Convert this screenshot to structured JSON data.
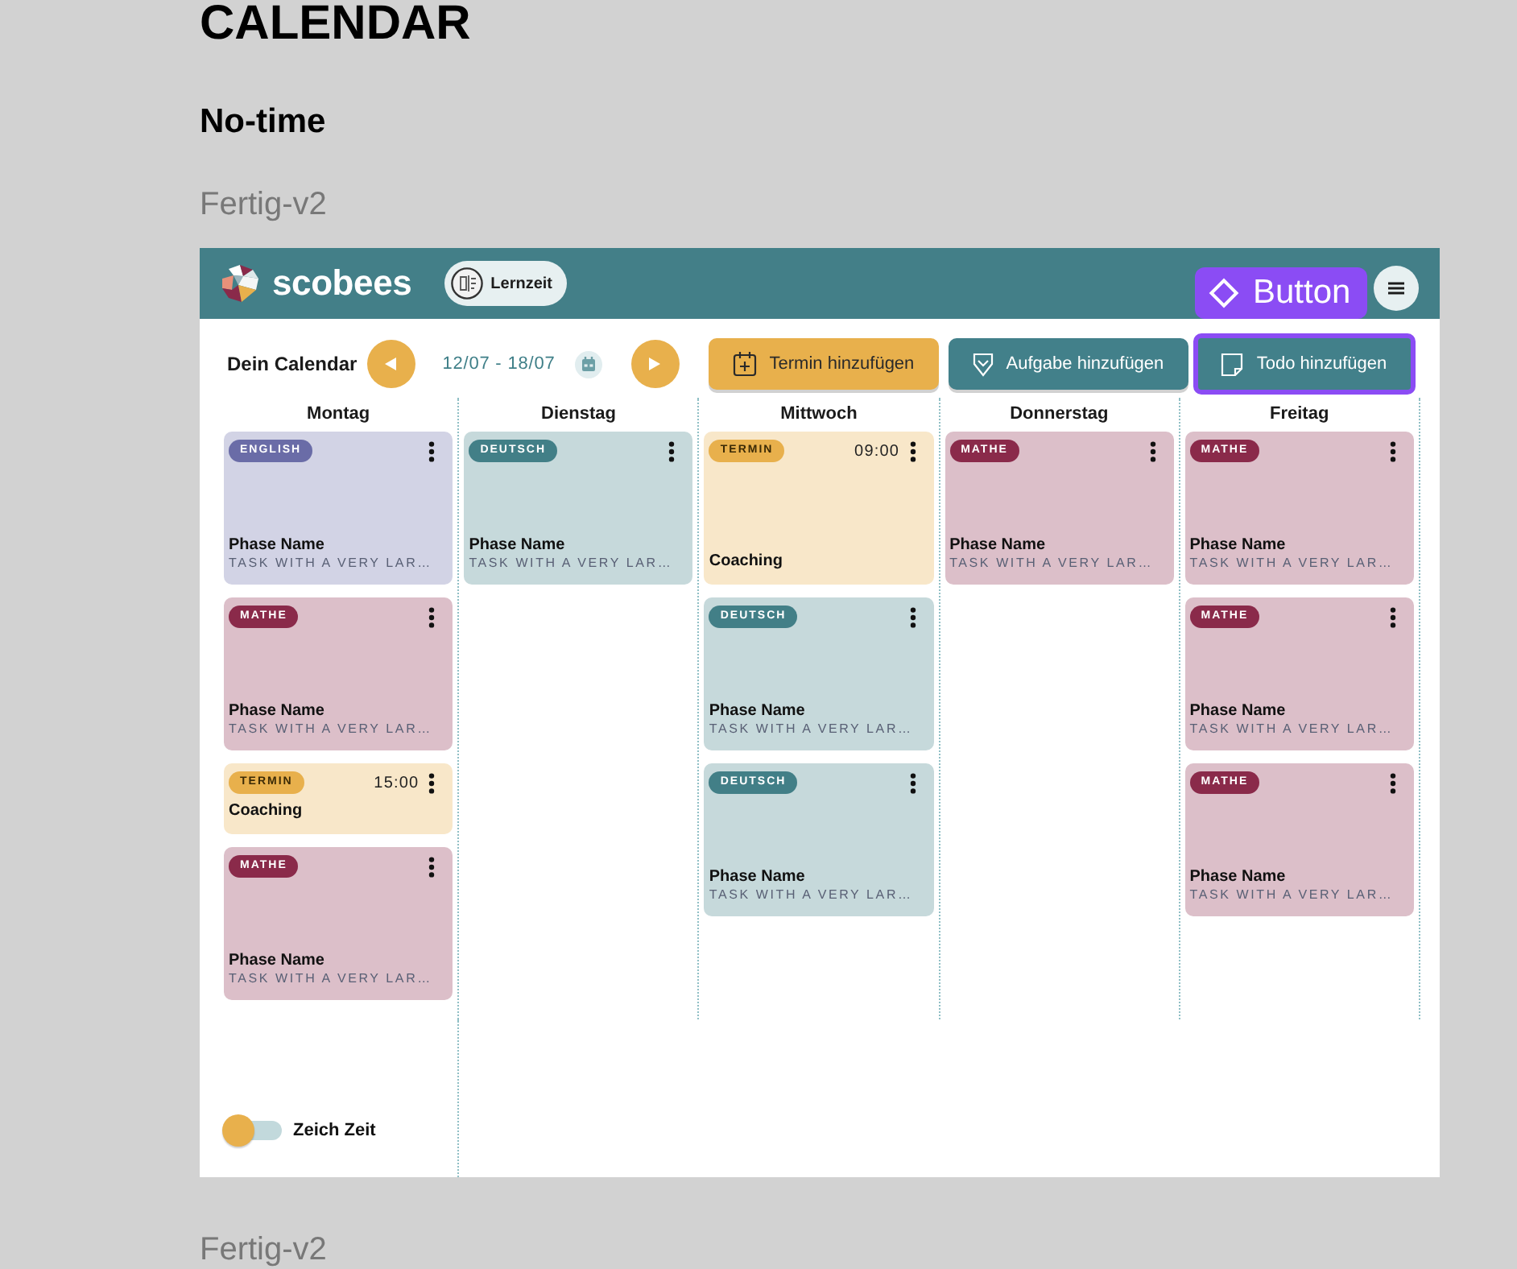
{
  "canvas": {
    "title": "CALENDAR",
    "section": "No-time",
    "frame_label": "Fertig-v2",
    "next_frame_label": "Fertig-v2"
  },
  "header": {
    "brand": "scobees",
    "mode_chip": "Lernzeit",
    "component_label": "Button"
  },
  "toolbar": {
    "title": "Dein Calendar",
    "date_range": "12/07 - 18/07",
    "buttons": [
      {
        "kind": "termin",
        "label": "Termin hinzufügen",
        "selected": false
      },
      {
        "kind": "aufgabe",
        "label": "Aufgabe hinzufügen",
        "selected": false
      },
      {
        "kind": "todo",
        "label": "Todo hinzufügen",
        "selected": true
      }
    ]
  },
  "days": [
    {
      "name": "Montag",
      "cards": [
        {
          "kind": "task",
          "tag": "ENGLISH",
          "color": "#6a6ca7",
          "title": "Phase Name",
          "task": "TASK WITH A VERY LAR…"
        },
        {
          "kind": "task",
          "tag": "MATHE",
          "color": "#8a2a4a",
          "title": "Phase Name",
          "task": "TASK WITH A VERY LAR…"
        },
        {
          "kind": "appointment",
          "tag": "TERMIN",
          "color": "#e8b04c",
          "time": "15:00",
          "title": "Coaching",
          "compact": true
        },
        {
          "kind": "task",
          "tag": "MATHE",
          "color": "#8a2a4a",
          "title": "Phase Name",
          "task": "TASK WITH A VERY LAR…"
        }
      ]
    },
    {
      "name": "Dienstag",
      "cards": [
        {
          "kind": "task",
          "tag": "DEUTSCH",
          "color": "#427f87",
          "title": "Phase Name",
          "task": "TASK WITH A VERY LAR…"
        }
      ]
    },
    {
      "name": "Mittwoch",
      "cards": [
        {
          "kind": "appointment",
          "tag": "TERMIN",
          "color": "#e8b04c",
          "time": "09:00",
          "title": "Coaching",
          "compact": false
        },
        {
          "kind": "task",
          "tag": "DEUTSCH",
          "color": "#427f87",
          "title": "Phase Name",
          "task": "TASK WITH A VERY LAR…"
        },
        {
          "kind": "task",
          "tag": "DEUTSCH",
          "color": "#427f87",
          "title": "Phase Name",
          "task": "TASK WITH A VERY LAR…"
        }
      ]
    },
    {
      "name": "Donnerstag",
      "cards": [
        {
          "kind": "task",
          "tag": "MATHE",
          "color": "#8a2a4a",
          "title": "Phase Name",
          "task": "TASK WITH A VERY LAR…"
        }
      ]
    },
    {
      "name": "Freitag",
      "cards": [
        {
          "kind": "task",
          "tag": "MATHE",
          "color": "#8a2a4a",
          "title": "Phase Name",
          "task": "TASK WITH A VERY LAR…"
        },
        {
          "kind": "task",
          "tag": "MATHE",
          "color": "#8a2a4a",
          "title": "Phase Name",
          "task": "TASK WITH A VERY LAR…"
        },
        {
          "kind": "task",
          "tag": "MATHE",
          "color": "#8a2a4a",
          "title": "Phase Name",
          "task": "TASK WITH A VERY LAR…"
        }
      ]
    }
  ],
  "toggle": {
    "label": "Zeich Zeit",
    "on": false
  }
}
